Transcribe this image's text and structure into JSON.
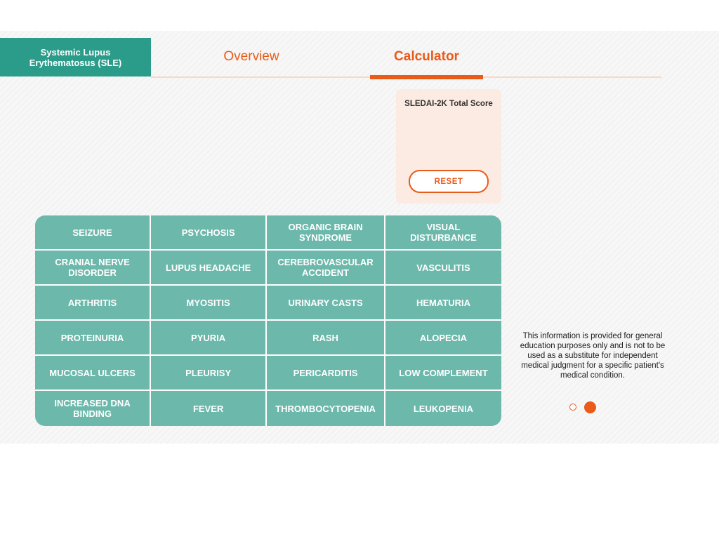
{
  "header": {
    "title": "Systemic Lupus Erythematosus (SLE)",
    "tabs": [
      {
        "label": "Overview",
        "active": false
      },
      {
        "label": "Calculator",
        "active": true
      }
    ]
  },
  "score": {
    "label": "SLEDAI-2K Total Score",
    "reset_label": "RESET"
  },
  "criteria": [
    "SEIZURE",
    "PSYCHOSIS",
    "ORGANIC BRAIN SYNDROME",
    "VISUAL DISTURBANCE",
    "CRANIAL NERVE DISORDER",
    "LUPUS HEADACHE",
    "CEREBROVASCULAR ACCIDENT",
    "VASCULITIS",
    "ARTHRITIS",
    "MYOSITIS",
    "URINARY CASTS",
    "HEMATURIA",
    "PROTEINURIA",
    "PYURIA",
    "RASH",
    "ALOPECIA",
    "MUCOSAL ULCERS",
    "PLEURISY",
    "PERICARDITIS",
    "LOW COMPLEMENT",
    "INCREASED DNA BINDING",
    "FEVER",
    "THROMBOCYTOPENIA",
    "LEUKOPENIA"
  ],
  "disclaimer": "This information is provided for general education purposes only and is not to be used as a substitute for independent medical judgment for a specific patient's medical condition.",
  "pagination": {
    "pages": 2,
    "current": 2
  },
  "colors": {
    "accent": "#ea5a19",
    "teal": "#2a9c89",
    "grid": "#6cb8ab",
    "score_bg": "#fcebe2"
  }
}
